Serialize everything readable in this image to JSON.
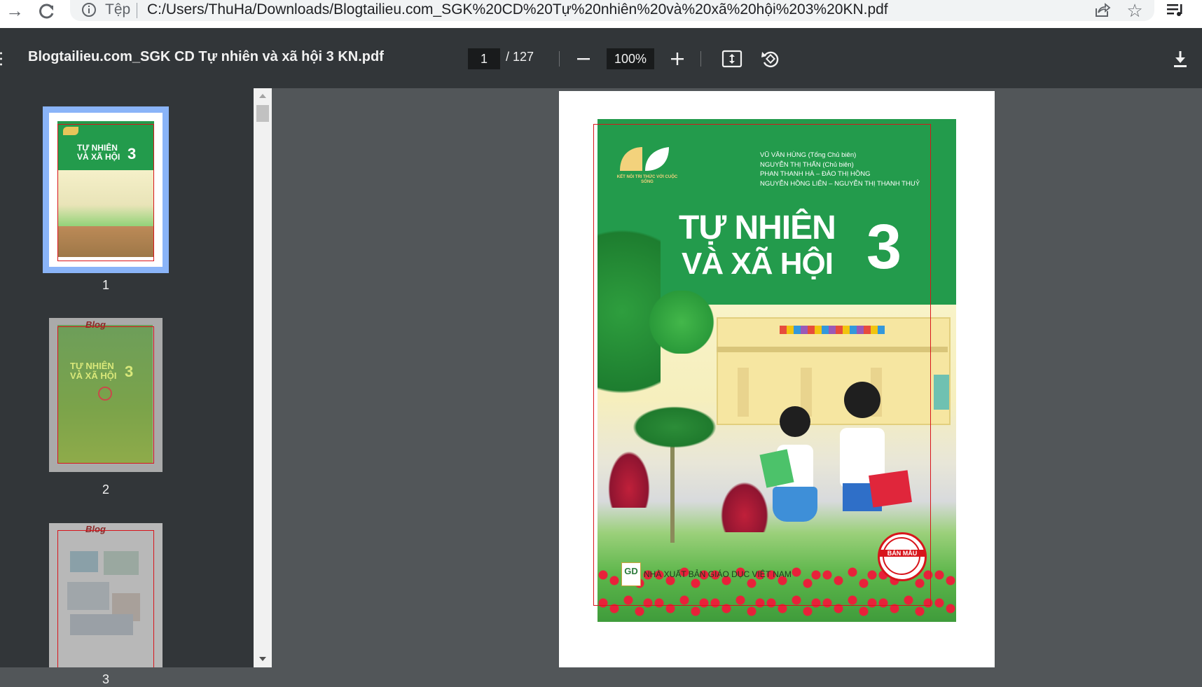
{
  "browser": {
    "url_scheme": "Tệp",
    "url": "C:/Users/ThuHa/Downloads/Blogtailieu.com_SGK%20CD%20Tự%20nhiên%20và%20xã%20hội%203%20KN.pdf",
    "icons": [
      "forward-icon",
      "reload-icon",
      "info-icon",
      "share-icon",
      "star-icon",
      "reading-list-icon"
    ]
  },
  "toolbar": {
    "title": "Blogtailieu.com_SGK CD Tự nhiên và xã hội 3 KN.pdf",
    "page_current": "1",
    "page_total": "/ 127",
    "zoom": "100%",
    "icons": [
      "menu-icon",
      "zoom-out-icon",
      "zoom-in-icon",
      "fit-page-icon",
      "rotate-icon",
      "download-icon"
    ]
  },
  "sidebar": {
    "thumbnails": [
      {
        "number": "1",
        "selected": true
      },
      {
        "number": "2",
        "selected": false
      },
      {
        "number": "3",
        "selected": false
      }
    ]
  },
  "cover": {
    "authors": [
      "VŨ VĂN HÙNG (Tổng Chủ biên)",
      "NGUYỄN THỊ THẤN (Chủ biên)",
      "PHAN THANH HÀ – ĐÀO THỊ HỒNG",
      "NGUYỄN HỒNG LIÊN – NGUYỄN THỊ THANH THUỶ"
    ],
    "series_logo_text": "KẾT NỐI TRI THỨC VỚI CUỘC SỐNG",
    "title_line1": "TỰ NHIÊN",
    "title_line2": "VÀ XÃ HỘI",
    "grade": "3",
    "publisher_logo": "GD",
    "publisher": "NHÀ XUẤT BẢN GIÁO DỤC VIỆT NAM",
    "stamp": "BẢN MẪU",
    "colors": {
      "green": "#239b4c",
      "accent_red": "#d8151b",
      "selection_blue": "#8ab4f8"
    }
  }
}
